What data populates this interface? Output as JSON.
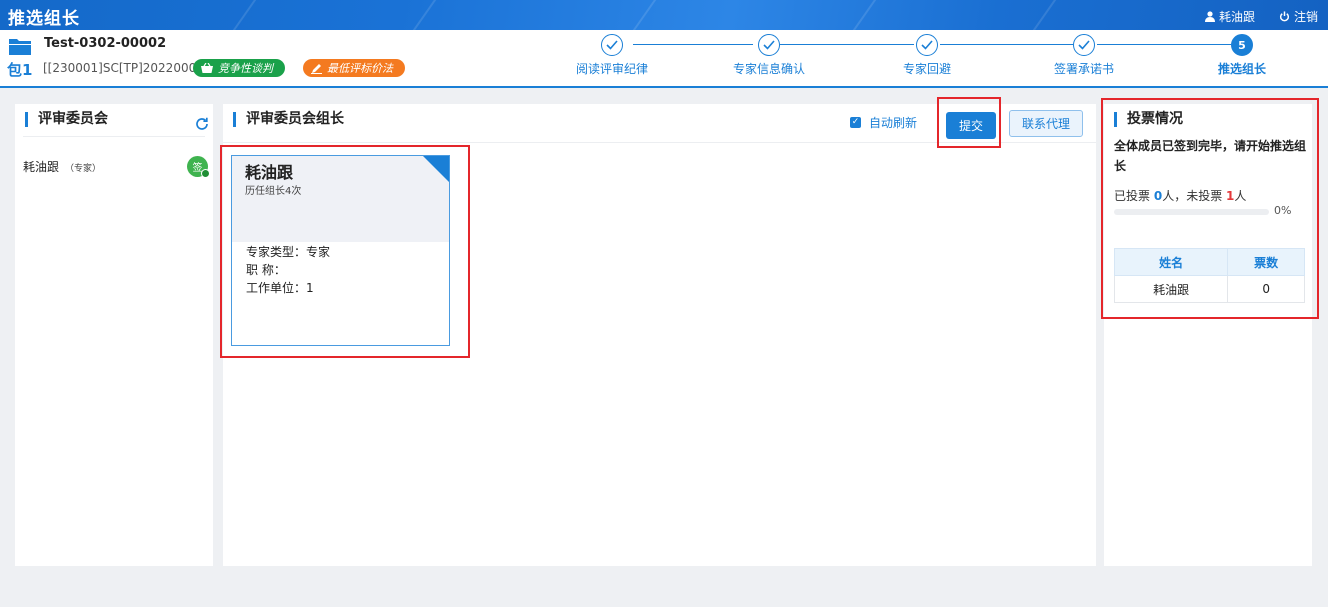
{
  "app": {
    "title": "推选组长",
    "user": "耗油跟",
    "logout": "注销"
  },
  "project": {
    "package_label": "包1",
    "title": "Test-0302-00002",
    "code": "[[230001]SC[TP]20220004 ]",
    "badges": [
      {
        "label": "竞争性谈判",
        "color": "#1aa14a"
      },
      {
        "label": "最低评标价法",
        "color": "#f47a20"
      }
    ]
  },
  "steps": [
    {
      "label": "阅读评审纪律",
      "status": "done"
    },
    {
      "label": "专家信息确认",
      "status": "done"
    },
    {
      "label": "专家回避",
      "status": "done"
    },
    {
      "label": "签署承诺书",
      "status": "done"
    },
    {
      "label": "推选组长",
      "number": "5",
      "status": "active"
    }
  ],
  "committee": {
    "title": "评审委员会",
    "members": [
      {
        "name": "耗油跟",
        "role": "（专家）",
        "sign_badge": "签"
      }
    ]
  },
  "leader": {
    "title": "评审委员会组长",
    "auto_refresh_label": "自动刷新",
    "auto_refresh_checked": true,
    "submit_label": "提交",
    "agent_label": "联系代理",
    "cards": [
      {
        "name": "耗油跟",
        "history": "历任组长4次",
        "type_line": "专家类型：专家",
        "title_line": "职 称：",
        "unit_line": "工作单位：1"
      }
    ]
  },
  "vote": {
    "title": "投票情况",
    "message": "全体成员已签到完毕，请开始推选组长",
    "voted_prefix": "已投票 ",
    "voted_count": "0",
    "voted_mid": "人，未投票 ",
    "unvoted_count": "1",
    "unvoted_suffix": "人",
    "progress_percent": 0,
    "progress_label": "0%",
    "headers": [
      "姓名",
      "票数"
    ],
    "rows": [
      {
        "name": "耗油跟",
        "votes": "0"
      }
    ]
  },
  "colors": {
    "accent": "#1a7fd6",
    "highlight": "#e4262b",
    "green": "#1aa14a",
    "orange": "#f47a20"
  }
}
